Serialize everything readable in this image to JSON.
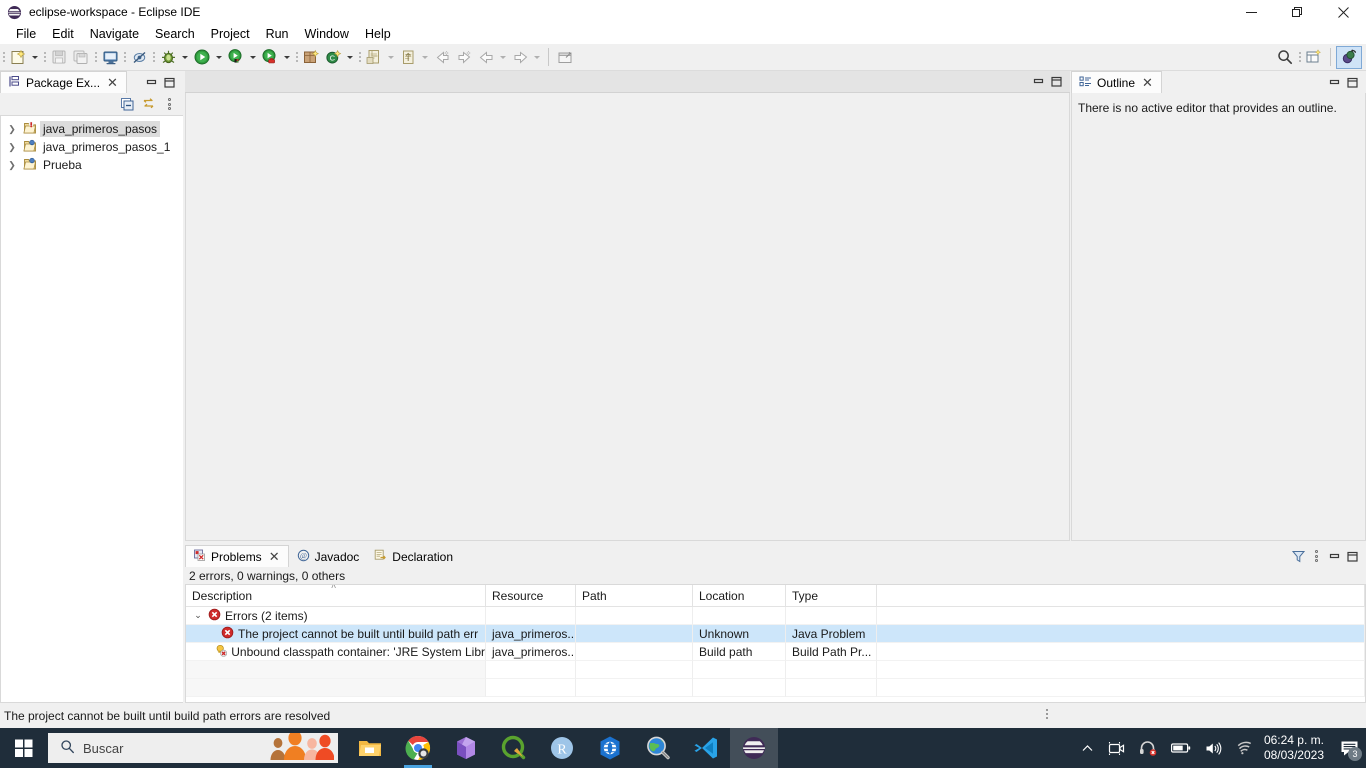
{
  "window": {
    "title": "eclipse-workspace - Eclipse IDE",
    "app_icon": "eclipse-icon",
    "minimize_glyph": "─",
    "maximize_glyph": "❐",
    "close_glyph": "✕"
  },
  "menubar": {
    "items": [
      {
        "label": "File"
      },
      {
        "label": "Edit"
      },
      {
        "label": "Navigate"
      },
      {
        "label": "Search"
      },
      {
        "label": "Project"
      },
      {
        "label": "Run"
      },
      {
        "label": "Window"
      },
      {
        "label": "Help"
      }
    ]
  },
  "toolbar": {
    "buttons": [
      {
        "name": "new-wizard",
        "title": "New"
      },
      {
        "name": "save",
        "title": "Save"
      },
      {
        "name": "save-all",
        "title": "Save All"
      },
      {
        "name": "print",
        "title": "Print"
      },
      {
        "name": "toggle-mark-occurrences",
        "title": "Toggle Mark Occurrences"
      },
      {
        "name": "debug",
        "title": "Debug"
      },
      {
        "name": "run",
        "title": "Run"
      },
      {
        "name": "run-coverage",
        "title": "Coverage"
      },
      {
        "name": "run-external-tools",
        "title": "External Tools"
      },
      {
        "name": "new-java-package",
        "title": "New Java Package"
      },
      {
        "name": "new-java-class",
        "title": "New Java Class"
      },
      {
        "name": "open-type",
        "title": "Open Type"
      },
      {
        "name": "quick-access-pencil",
        "title": "Edit"
      },
      {
        "name": "next-annotation",
        "title": "Next Annotation"
      },
      {
        "name": "previous-annotation",
        "title": "Previous Annotation"
      },
      {
        "name": "last-edit-location",
        "title": "Last Edit Location"
      },
      {
        "name": "forward-edit",
        "title": "Forward Edit"
      },
      {
        "name": "back",
        "title": "Back"
      },
      {
        "name": "forward",
        "title": "Forward"
      },
      {
        "name": "pin-editor",
        "title": "Pin Editor"
      },
      {
        "name": "search",
        "title": "Search"
      },
      {
        "name": "open-perspective",
        "title": "Open Perspective"
      },
      {
        "name": "java-perspective",
        "title": "Java Perspective"
      }
    ]
  },
  "package_explorer": {
    "tab_label": "Package Ex...",
    "tab_icon": "package-explorer-icon",
    "close_glyph": "✕",
    "minimize_glyph": "─",
    "maximize_glyph": "❐",
    "tools": [
      {
        "name": "collapse-all-icon",
        "title": "Collapse All"
      },
      {
        "name": "link-with-editor-icon",
        "title": "Link with Editor"
      },
      {
        "name": "view-menu-icon",
        "title": "View Menu"
      }
    ],
    "tree": [
      {
        "label": "java_primeros_pasos",
        "icon": "java-project-error-icon",
        "expanded": false,
        "selected": true
      },
      {
        "label": "java_primeros_pasos_1",
        "icon": "java-project-icon",
        "expanded": false,
        "selected": false
      },
      {
        "label": "Prueba",
        "icon": "java-project-icon",
        "expanded": false,
        "selected": false
      }
    ]
  },
  "editor_area": {
    "minimize_glyph": "─",
    "maximize_glyph": "❐",
    "content": ""
  },
  "outline": {
    "tab_label": "Outline",
    "tab_icon": "outline-icon",
    "close_glyph": "✕",
    "minimize_glyph": "─",
    "maximize_glyph": "❐",
    "empty_message": "There is no active editor that provides an outline."
  },
  "problems": {
    "tabs": [
      {
        "label": "Problems",
        "icon": "problems-icon",
        "active": true,
        "closeable": true
      },
      {
        "label": "Javadoc",
        "icon": "javadoc-icon",
        "active": false,
        "closeable": false
      },
      {
        "label": "Declaration",
        "icon": "declaration-icon",
        "active": false,
        "closeable": false
      }
    ],
    "close_glyph": "✕",
    "tools": [
      {
        "name": "filters-icon",
        "title": "Filters"
      },
      {
        "name": "view-menu-icon",
        "title": "View Menu"
      },
      {
        "name": "minimize-icon",
        "title": "Minimize"
      },
      {
        "name": "maximize-icon",
        "title": "Maximize"
      }
    ],
    "summary": "2 errors, 0 warnings, 0 others",
    "columns": [
      "Description",
      "Resource",
      "Path",
      "Location",
      "Type"
    ],
    "sort_indicator": "˄",
    "rows": [
      {
        "kind": "group",
        "twisty": "⌄",
        "icon": "error-icon",
        "description": "Errors (2 items)",
        "resource": "",
        "path": "",
        "location": "",
        "type": "",
        "highlight": false
      },
      {
        "kind": "item",
        "twisty": "",
        "icon": "error-icon",
        "description": "The project cannot be built until build path err",
        "resource": "java_primeros...",
        "path": "",
        "location": "Unknown",
        "type": "Java Problem",
        "highlight": true
      },
      {
        "kind": "item",
        "twisty": "",
        "icon": "buildpath-error-icon",
        "description": "Unbound classpath container: 'JRE System Libr",
        "resource": "java_primeros...",
        "path": "",
        "location": "Build path",
        "type": "Build Path Pr...",
        "highlight": false
      }
    ]
  },
  "statusbar": {
    "message": "The project cannot be built until build path errors are resolved"
  },
  "taskbar": {
    "start_icon": "windows-start-icon",
    "search_placeholder": "Buscar",
    "search_icon": "search-icon",
    "apps": [
      {
        "name": "file-explorer-icon",
        "label": "File Explorer",
        "active": false,
        "running": false
      },
      {
        "name": "google-chrome-icon",
        "label": "Google Chrome",
        "active": false,
        "running": true
      },
      {
        "name": "microsoft-office-icon",
        "label": "Microsoft Office",
        "active": false,
        "running": false
      },
      {
        "name": "qgis-icon",
        "label": "QGIS",
        "active": false,
        "running": false
      },
      {
        "name": "rstudio-icon",
        "label": "R",
        "active": false,
        "running": false
      },
      {
        "name": "globe-app-icon",
        "label": "Globe App",
        "active": false,
        "running": false
      },
      {
        "name": "search-earth-icon",
        "label": "Earth Search",
        "active": false,
        "running": false
      },
      {
        "name": "vscode-icon",
        "label": "Visual Studio Code",
        "active": false,
        "running": false
      },
      {
        "name": "eclipse-icon",
        "label": "Eclipse IDE",
        "active": true,
        "running": true
      }
    ],
    "tray": [
      {
        "name": "show-hidden-icons-chevron",
        "glyph": "⌃"
      },
      {
        "name": "camera-icon"
      },
      {
        "name": "headset-muted-icon"
      },
      {
        "name": "battery-icon"
      },
      {
        "name": "volume-icon"
      },
      {
        "name": "wifi-icon"
      }
    ],
    "clock": {
      "time": "06:24 p. m.",
      "date": "08/03/2023"
    },
    "notifications": {
      "icon": "notifications-icon",
      "count": "3"
    }
  },
  "colors": {
    "accent_blue": "#cde6fa",
    "selection_gray": "#dcdcdc",
    "taskbar_bg": "#1f2d3a",
    "chrome_bg": "#f0f0f0",
    "error_red": "#d32424",
    "eclipse_purple": "#3f2a56"
  }
}
